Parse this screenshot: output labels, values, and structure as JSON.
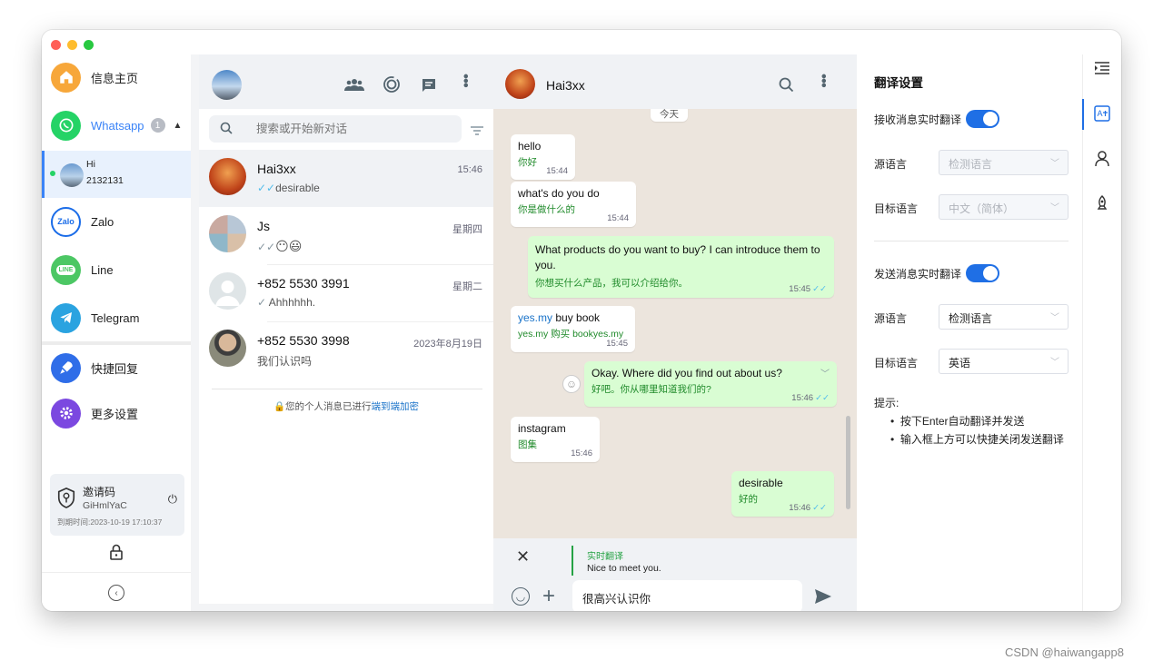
{
  "sidebar": {
    "home": "信息主页",
    "whatsapp": "Whatsapp",
    "whatsapp_badge": "1",
    "account_name": "Hi",
    "account_id": "2132131",
    "zalo": "Zalo",
    "zalo_logo": "Zalo",
    "line": "Line",
    "line_logo": "LINE",
    "telegram": "Telegram",
    "quick_reply": "快捷回复",
    "more_settings": "更多设置",
    "invite_title": "邀请码",
    "invite_code": "GiHmlYaC",
    "invite_expiry": "到期时间:2023-10-19 17:10:37"
  },
  "chatlist": {
    "search_placeholder": "搜索或开始新对话",
    "chats": [
      {
        "name": "Hai3xx",
        "preview": "desirable",
        "time": "15:46",
        "ticks": "✓✓"
      },
      {
        "name": "Js",
        "preview": "😶😃",
        "time": "星期四",
        "ticks": "✓✓"
      },
      {
        "name": "+852 5530 3991",
        "preview": "Ahhhhhh.",
        "time": "星期二",
        "ticks": "✓"
      },
      {
        "name": "+852 5530 3998",
        "preview": "我们认识吗",
        "time": "2023年8月19日",
        "ticks": ""
      }
    ],
    "e2e_text": "您的个人消息已进行",
    "e2e_link": "端到端加密"
  },
  "chat": {
    "contact_name": "Hai3xx",
    "date_chip": "今天",
    "messages": [
      {
        "text": "hello",
        "translation": "你好",
        "time": "15:44"
      },
      {
        "text": "what's do you do",
        "translation": "你是做什么的",
        "time": "15:44"
      },
      {
        "text": "What products do you want to buy? I can introduce them to you.",
        "translation": "你想买什么产品，我可以介绍给你。",
        "time": "15:45"
      },
      {
        "link": "yes.my",
        "text": " buy book",
        "translation": "yes.my 购买 bookyes.my",
        "time": "15:45"
      },
      {
        "text": "Okay. Where did you find out about us?",
        "translation": "好吧。你从哪里知道我们的?",
        "time": "15:46"
      },
      {
        "text": "instagram",
        "translation": "图集",
        "time": "15:46"
      },
      {
        "text": "desirable",
        "translation": "好的",
        "time": "15:46"
      }
    ],
    "realtime_label": "实时翻译",
    "realtime_text": "Nice to meet you.",
    "input_value": "很高兴认识你"
  },
  "translate": {
    "title": "翻译设置",
    "receive_label": "接收消息实时翻译",
    "send_label": "发送消息实时翻译",
    "source_label": "源语言",
    "target_label": "目标语言",
    "recv_source": "检测语言",
    "recv_target": "中文（简体）",
    "send_source": "检测语言",
    "send_target": "英语",
    "tips_title": "提示:",
    "tips": [
      "按下Enter自动翻译并发送",
      "输入框上方可以快捷关闭发送翻译"
    ]
  },
  "watermark": "CSDN @haiwangapp8",
  "colors": {
    "accent": "#1f6fe5",
    "whatsapp": "#25d366",
    "out_bubble": "#d9fdd3",
    "chat_bg": "#ece5dd"
  }
}
